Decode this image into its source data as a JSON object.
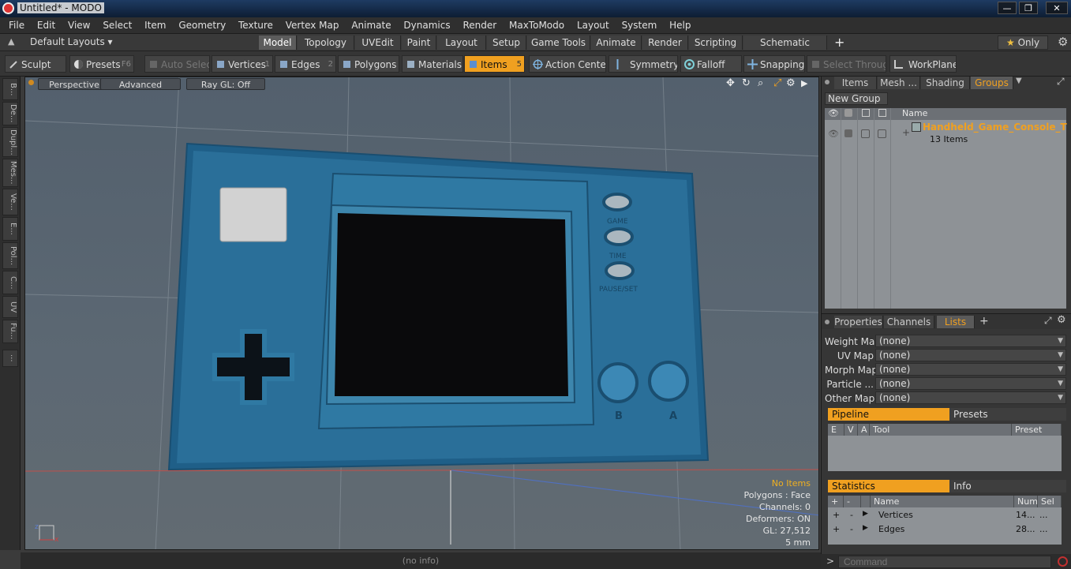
{
  "window": {
    "title": "Untitled* - MODO",
    "buttons": {
      "minimize": "—",
      "maximize": "❐",
      "close": "✕"
    }
  },
  "menu": [
    "File",
    "Edit",
    "View",
    "Select",
    "Item",
    "Geometry",
    "Texture",
    "Vertex Map",
    "Animate",
    "Dynamics",
    "Render",
    "MaxToModo",
    "Layout",
    "System",
    "Help"
  ],
  "layoutbar": {
    "default_layouts": "Default Layouts",
    "tabs": [
      "Model",
      "Topology",
      "UVEdit",
      "Paint",
      "Layout",
      "Setup",
      "Game Tools",
      "Animate",
      "Render",
      "Scripting",
      "Schematic Fusion"
    ],
    "active_tab": "Model",
    "add": "+",
    "only": "Only"
  },
  "toolbar": {
    "sculpt": "Sculpt",
    "presets": "Presets",
    "presets_key": "F6",
    "auto_select": "Auto Select",
    "vertices": "Vertices",
    "vertices_num": "1",
    "edges": "Edges",
    "edges_num": "2",
    "polygons": "Polygons",
    "materials": "Materials",
    "items": "Items",
    "items_num": "5",
    "action_center": "Action Center",
    "symmetry": "Symmetry",
    "falloff": "Falloff",
    "snapping": "Snapping",
    "select_through": "Select Through",
    "workplane": "WorkPlane"
  },
  "left_tabs": [
    "B...",
    "De...",
    "Dupl...",
    "Mes...",
    "Ve...",
    "E...",
    "Pol...",
    "C...",
    "UV",
    "Fu..."
  ],
  "left_tab_extra": "...",
  "viewport": {
    "perspective": "Perspective",
    "advanced": "Advanced",
    "raygl": "Ray GL: Off",
    "model_labels": {
      "game": "GAME",
      "time": "TIME",
      "pause": "PAUSE/SET",
      "b": "B",
      "a": "A"
    },
    "stats": [
      "No Items",
      "Polygons : Face",
      "Channels: 0",
      "Deformers: ON",
      "GL: 27,512",
      "5 mm"
    ],
    "axis_x": "x",
    "axis_z": "z"
  },
  "status": {
    "info": "(no info)"
  },
  "groups_panel": {
    "tabs": [
      "Items",
      "Mesh ...",
      "Shading",
      "Groups"
    ],
    "active_tab": "Groups",
    "new_group": "New Group",
    "name_col": "Name",
    "group_name": "Handheld_Game_Console_T ...",
    "group_count": "13 Items"
  },
  "lists_panel": {
    "tabs": [
      "Properties",
      "Channels",
      "Lists"
    ],
    "active_tab": "Lists",
    "add": "+",
    "rows": [
      {
        "label": "Weight Map",
        "value": "(none)"
      },
      {
        "label": "UV Map",
        "value": "(none)"
      },
      {
        "label": "Morph Map",
        "value": "(none)"
      },
      {
        "label": "Particle ...",
        "value": "(none)"
      },
      {
        "label": "Other Map",
        "value": "(none)"
      }
    ],
    "pipeline": "Pipeline",
    "presets": "Presets",
    "pipeline_cols": [
      "E",
      "V",
      "A",
      "Tool",
      "Preset"
    ]
  },
  "stats_panel": {
    "statistics": "Statistics",
    "info": "Info",
    "cols": [
      "+",
      "-",
      "Name",
      "Num",
      "Sel"
    ],
    "rows": [
      {
        "plus": "+",
        "minus": "-",
        "name": "Vertices",
        "num": "14...",
        "sel": "..."
      },
      {
        "plus": "+",
        "minus": "-",
        "name": "Edges",
        "num": "28...",
        "sel": "..."
      }
    ]
  },
  "command": {
    "prompt": ">",
    "placeholder": "Command"
  },
  "colors": {
    "accent": "#f0a020",
    "console_blue": "#2a6f99",
    "screen": "#0a0a0c"
  }
}
